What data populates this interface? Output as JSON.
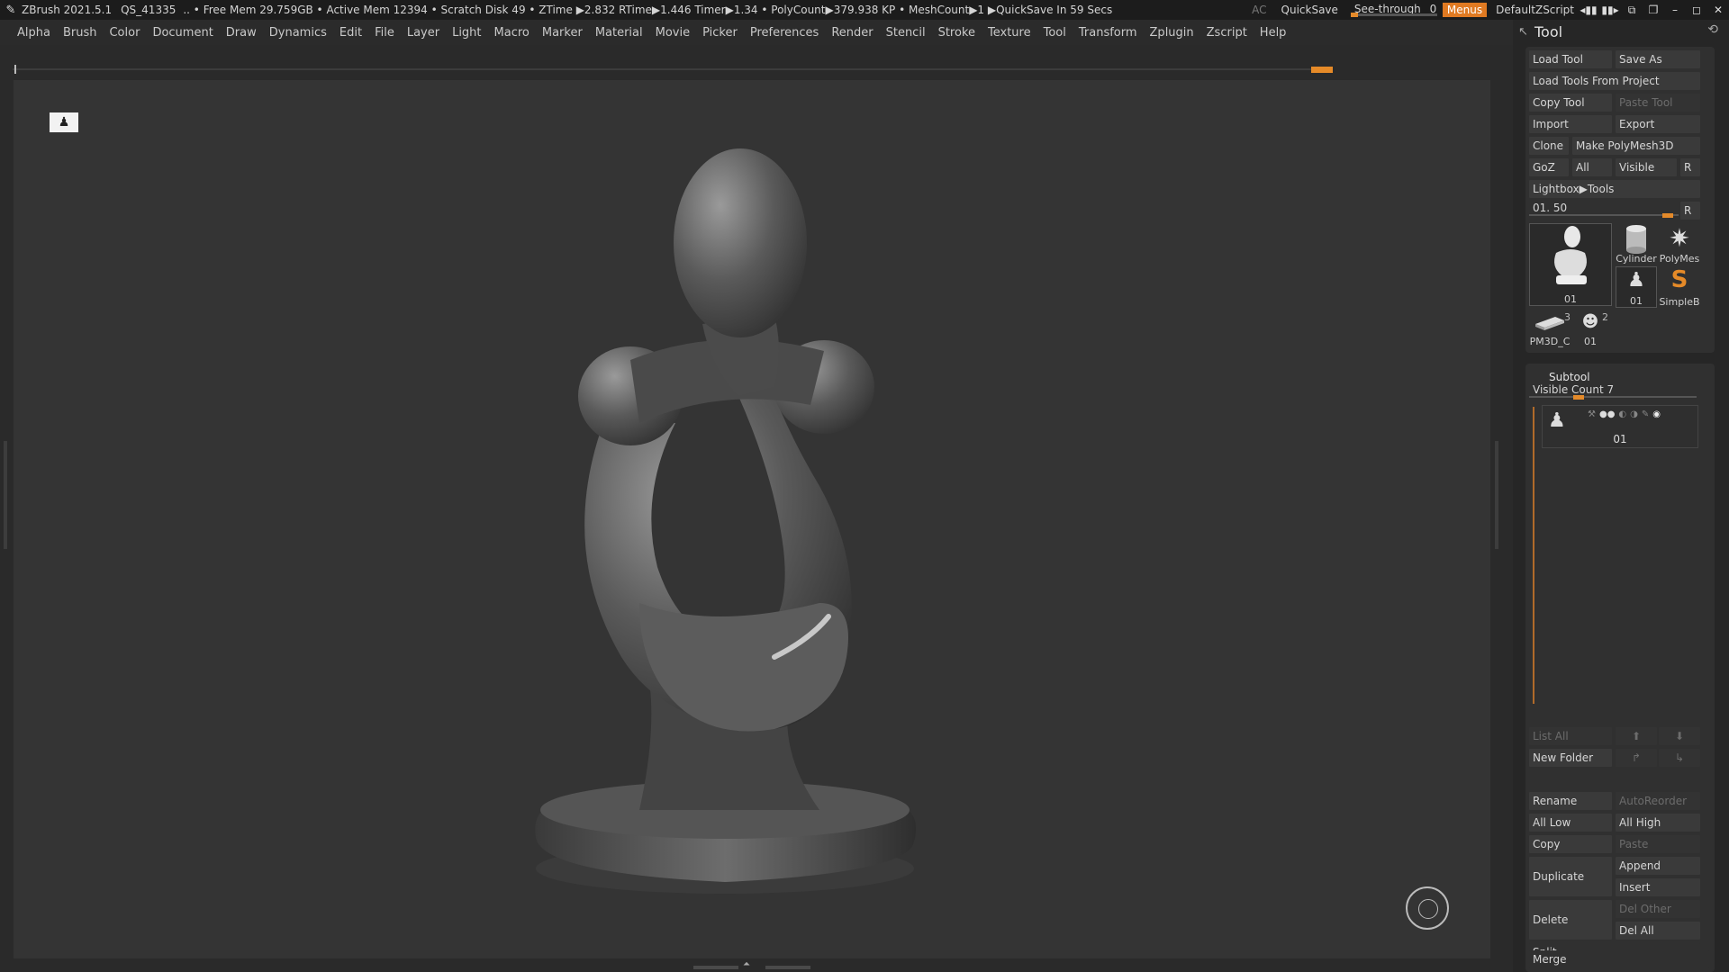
{
  "title_bar": {
    "app": "ZBrush 2021.5.1",
    "doc_id": "QS_41335",
    "stats": ".. • Free Mem 29.759GB • Active Mem 12394 • Scratch Disk 49 • ZTime ▶2.832 RTime▶1.446 Timer▶1.34 • PolyCount▶379.938 KP • MeshCount▶1 ▶QuickSave In 59 Secs",
    "ac": "AC",
    "quicksave": "QuickSave",
    "see_through_label": "See-through",
    "see_through_value": "0",
    "see_through_fraction": 0,
    "menus": "Menus",
    "script": "DefaultZScript"
  },
  "menu_bar": [
    "Alpha",
    "Brush",
    "Color",
    "Document",
    "Draw",
    "Dynamics",
    "Edit",
    "File",
    "Layer",
    "Light",
    "Macro",
    "Marker",
    "Material",
    "Movie",
    "Picker",
    "Preferences",
    "Render",
    "Stencil",
    "Stroke",
    "Texture",
    "Tool",
    "Transform",
    "Zplugin",
    "Zscript",
    "Help"
  ],
  "tool_panel": {
    "title": "Tool",
    "load_tool": "Load Tool",
    "save_as": "Save As",
    "load_from_project": "Load Tools From Project",
    "copy_tool": "Copy Tool",
    "paste_tool": "Paste Tool",
    "import": "Import",
    "export": "Export",
    "clone": "Clone",
    "make_polymesh": "Make PolyMesh3D",
    "goz": "GoZ",
    "all": "All",
    "visible": "Visible",
    "r": "R",
    "lightbox_tools": "Lightbox▶Tools",
    "tool_slider_label": "01. 50",
    "tool_slider_fraction": 0.96,
    "thumbnails": [
      {
        "label": "01",
        "badge": ""
      },
      {
        "label": "Cylinder",
        "badge": ""
      },
      {
        "label": "PolyMes",
        "badge": ""
      },
      {
        "label": "01",
        "badge": ""
      },
      {
        "label": "SimpleB",
        "badge": ""
      },
      {
        "label": "PM3D_C",
        "badge": "3"
      },
      {
        "label": "01",
        "badge": "2"
      }
    ]
  },
  "subtool": {
    "title": "Subtool",
    "visible_count": "Visible Count 7",
    "visible_count_fraction": 0.28,
    "item_label": "01",
    "list_all": "List All",
    "new_folder": "New Folder",
    "rename": "Rename",
    "auto_reorder": "AutoReorder",
    "all_low": "All Low",
    "all_high": "All High",
    "copy": "Copy",
    "paste": "Paste",
    "duplicate": "Duplicate",
    "append": "Append",
    "insert": "Insert",
    "delete": "Delete",
    "del_other": "Del Other",
    "del_all": "Del All",
    "split": "Split",
    "merge": "Merge"
  },
  "colors": {
    "accent": "#e07a22",
    "panel_bg": "#262626",
    "viewport_bg": "#343434"
  }
}
